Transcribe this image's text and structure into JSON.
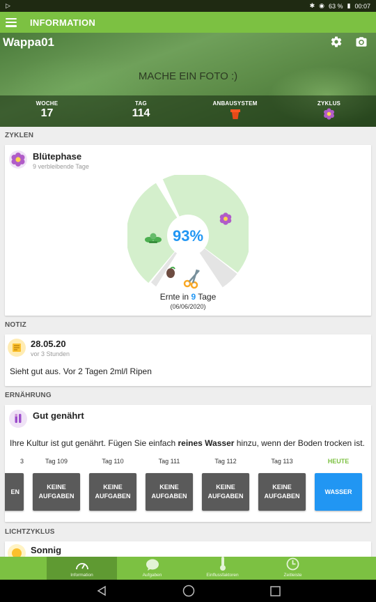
{
  "statusbar": {
    "left_icon": "play-icon",
    "battery": "63 %",
    "time": "00:07"
  },
  "appbar": {
    "title": "INFORMATION"
  },
  "header": {
    "plant_name": "Wappa01",
    "photo_label": "MACHE EIN FOTO :)",
    "stats": [
      {
        "label": "WOCHE",
        "value": "17"
      },
      {
        "label": "TAG",
        "value": "114"
      },
      {
        "label": "ANBAUSYSTEM",
        "icon": "pot-icon"
      },
      {
        "label": "ZYKLUS",
        "icon": "flower-icon"
      }
    ]
  },
  "cycles": {
    "section": "ZYKLEN",
    "title": "Blütephase",
    "subtitle": "9 verbleibende Tage",
    "percent": "93%",
    "harvest_prefix": "Ernte in ",
    "harvest_days": "9",
    "harvest_suffix": " Tage",
    "harvest_date": "(06/06/2020)",
    "progress_fraction": 0.93
  },
  "note": {
    "section": "NOTIZ",
    "date": "28.05.20",
    "ago": "vor 3 Stunden",
    "text": "Sieht gut aus. Vor 2 Tagen 2ml/l Ripen"
  },
  "nutrition": {
    "section": "ERNÄHRUNG",
    "title": "Gut genährt",
    "text_before": "Ihre Kultur ist gut genährt. Fügen Sie einfach ",
    "text_bold": "reines Wasser",
    "text_after": " hinzu, wenn der Boden trocken ist.",
    "days": [
      {
        "label": "3",
        "tile": "EN"
      },
      {
        "label": "Tag 109",
        "tile": "KEINE AUFGABEN"
      },
      {
        "label": "Tag 110",
        "tile": "KEINE AUFGABEN"
      },
      {
        "label": "Tag 111",
        "tile": "KEINE AUFGABEN"
      },
      {
        "label": "Tag 112",
        "tile": "KEINE AUFGABEN"
      },
      {
        "label": "Tag 113",
        "tile": "KEINE AUFGABEN"
      },
      {
        "label": "HEUTE",
        "tile": "WASSER"
      }
    ]
  },
  "light": {
    "section": "LICHTZYKLUS",
    "title": "Sonnig"
  },
  "bottomnav": [
    {
      "label": "Information",
      "icon": "speedometer-icon"
    },
    {
      "label": "Aufgaben",
      "icon": "chat-bubble-icon"
    },
    {
      "label": "Einflussfaktoren",
      "icon": "thermometer-icon"
    },
    {
      "label": "Zeitleiste",
      "icon": "clock-icon"
    }
  ],
  "colors": {
    "accent": "#7cc142",
    "blue": "#2196f3",
    "tile_gray": "#5a5a5a",
    "chart_green": "#d4efcc"
  }
}
